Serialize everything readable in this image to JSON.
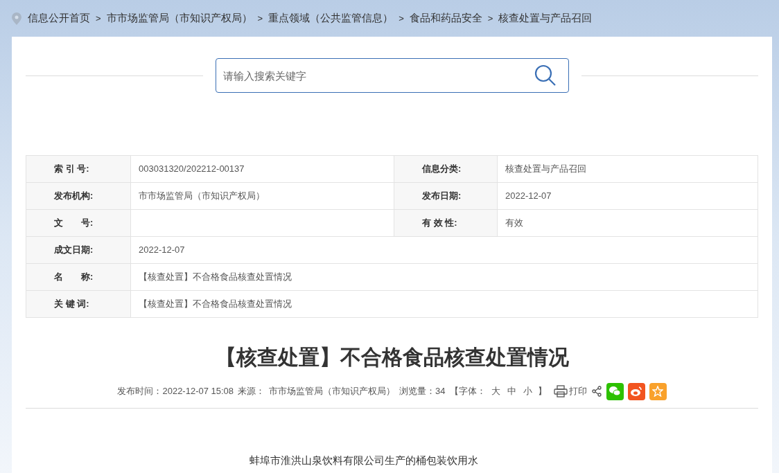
{
  "breadcrumb": [
    {
      "kind": "link",
      "text": "信息公开首页"
    },
    {
      "kind": "separator",
      "text": ">"
    },
    {
      "kind": "link",
      "text": "市市场监管局（市知识产权局）"
    },
    {
      "kind": "separator",
      "text": ">"
    },
    {
      "kind": "link",
      "text": "重点领域（公共监管信息）"
    },
    {
      "kind": "separator",
      "text": ">"
    },
    {
      "kind": "link",
      "text": "食品和药品安全"
    },
    {
      "kind": "separator",
      "text": ">"
    },
    {
      "kind": "link",
      "text": "核查处置与产品召回"
    }
  ],
  "search": {
    "placeholder": "请输入搜索关键字"
  },
  "info_table": [
    {
      "cells": [
        {
          "label": "索 引 号:",
          "value": "003031320/202212-00137"
        },
        {
          "label": "信息分类:",
          "value": "核查处置与产品召回"
        }
      ]
    },
    {
      "cells": [
        {
          "label": "发布机构:",
          "value": "市市场监管局（市知识产权局）"
        },
        {
          "label": "发布日期:",
          "value": "2022-12-07"
        }
      ]
    },
    {
      "cells": [
        {
          "label": "文　　号:"
        },
        {
          "label": "有 效 性:",
          "value": "有效"
        }
      ]
    },
    {
      "cells": [
        {
          "label": "成文日期:",
          "value": "2022-12-07"
        }
      ]
    },
    {
      "cells": [
        {
          "label": "名　　称:",
          "value": "【核查处置】不合格食品核查处置情况"
        }
      ]
    },
    {
      "cells": [
        {
          "label": "关 键 词:",
          "value": "【核查处置】不合格食品核查处置情况"
        }
      ]
    }
  ],
  "article": {
    "title": "【核查处置】不合格食品核查处置情况",
    "meta": {
      "published": "发布时间：2022-12-07 15:08",
      "source_label": "来源：",
      "source": "市市场监管局（市知识产权局）",
      "views": "浏览量：34",
      "font_open": "【字体：",
      "font_sizes": [
        "大",
        "中",
        "小"
      ],
      "font_close": "】",
      "print": "打印"
    },
    "share": [
      {
        "kind": "share"
      },
      {
        "kind": "wechat"
      },
      {
        "kind": "weibo"
      },
      {
        "kind": "favorite"
      }
    ],
    "body": "蚌埠市淮洪山泉饮料有限公司生产的桶包装饮用水"
  }
}
